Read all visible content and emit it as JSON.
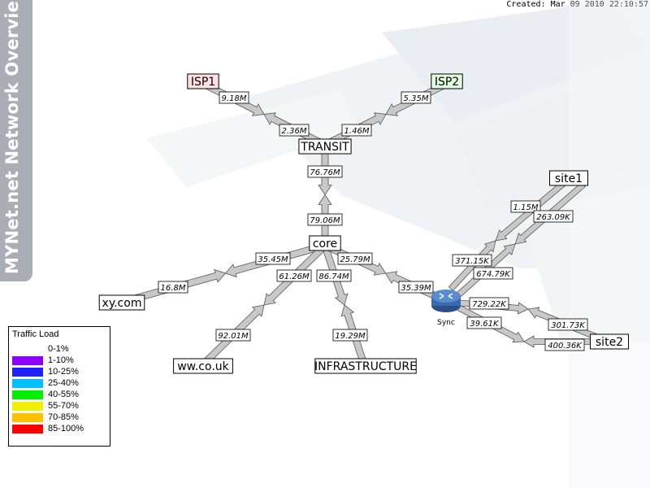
{
  "map_title": "MYNet.net Network Overview",
  "created": "Created: Mar 09 2010 22:10:57",
  "nodes": {
    "isp1": "ISP1",
    "isp2": "ISP2",
    "transit": "TRANSIT",
    "core": "core",
    "xy": "xy.com",
    "wwco": "ww.co.uk",
    "infra": "INFRASTRUCTURE",
    "site1": "site1",
    "site2": "site2",
    "sync": "Sync"
  },
  "links": {
    "isp1_transit_out": "9.18M",
    "isp1_transit_in": "2.36M",
    "isp2_transit_out": "5.35M",
    "isp2_transit_in": "1.46M",
    "transit_core_out": "76.76M",
    "transit_core_in": "79.06M",
    "core_xy_out": "35.45M",
    "core_xy_in": "16.8M",
    "core_ww_out": "61.26M",
    "core_ww_in": "92.01M",
    "core_infra_out": "86.74M",
    "core_infra_in": "19.29M",
    "core_sync_out": "25.79M",
    "core_sync_in": "35.39M",
    "site1_a_in": "1.15M",
    "site1_a_out": "371.15K",
    "site1_b_in": "263.09K",
    "site1_b_out": "674.79K",
    "sync_site2_a_out": "729.22K",
    "sync_site2_a_in": "301.73K",
    "sync_site2_b_out": "39.61K",
    "sync_site2_b_in": "400.36K"
  },
  "legend": {
    "title": "Traffic Load",
    "items": [
      {
        "label": "0-1%",
        "color": "#ffffff"
      },
      {
        "label": "1-10%",
        "color": "#8c00ff"
      },
      {
        "label": "10-25%",
        "color": "#2020ff"
      },
      {
        "label": "25-40%",
        "color": "#00c0ff"
      },
      {
        "label": "40-55%",
        "color": "#00f000"
      },
      {
        "label": "55-70%",
        "color": "#f0f000"
      },
      {
        "label": "70-85%",
        "color": "#ffc000"
      },
      {
        "label": "85-100%",
        "color": "#ff0000"
      }
    ]
  },
  "colors": {
    "link_fill": "#c8c8c8",
    "isp1_bg": "#ffe0e0",
    "isp2_bg": "#e0ffe0",
    "router": "#3a6ab0"
  }
}
